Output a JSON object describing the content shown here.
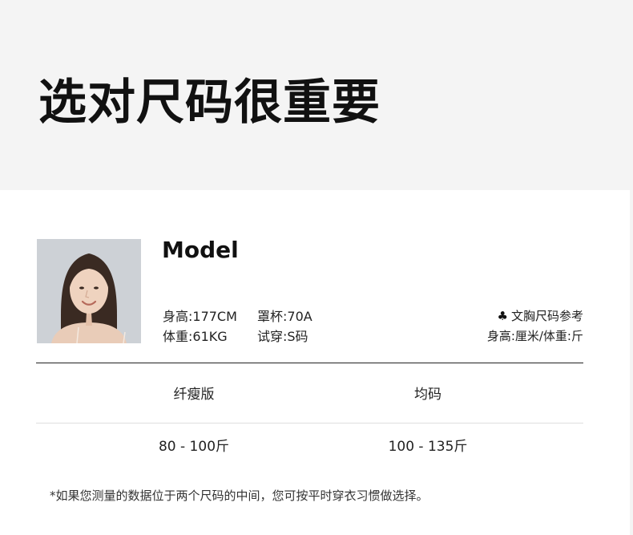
{
  "hero": {
    "title": "选对尺码很重要"
  },
  "model": {
    "title": "Model",
    "photo_icon": "model-portrait",
    "specs": {
      "height": "身高:177CM",
      "weight": "体重:61KG",
      "cup": "罩杯:70A",
      "trial": "试穿:S码"
    },
    "reference": {
      "icon": "club-icon",
      "label": "文胸尺码参考",
      "unit_note": "身高:厘米/体重:斤"
    }
  },
  "size_table": {
    "headers": [
      "纤瘦版",
      "均码"
    ],
    "rows": [
      [
        "80 - 100斤",
        "100 - 135斤"
      ]
    ]
  },
  "footnote": "*如果您测量的数据位于两个尺码的中间，您可按平时穿衣习惯做选择。",
  "colors": {
    "hero_bg": "#f4f4f4",
    "text": "#111111",
    "rule_dark": "#222222",
    "rule_light": "#dedede"
  }
}
